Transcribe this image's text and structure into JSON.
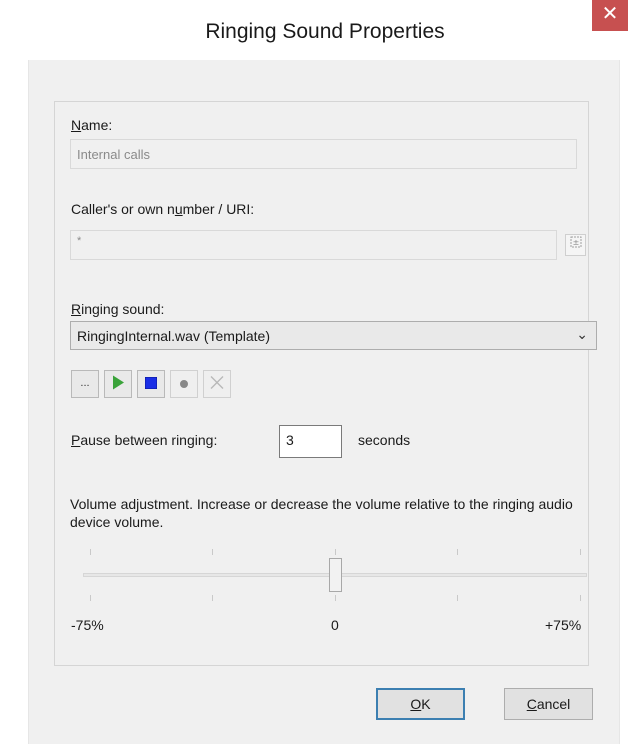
{
  "window": {
    "title": "Ringing Sound Properties"
  },
  "name": {
    "label": "Name:",
    "value": "Internal calls"
  },
  "number": {
    "label": "Caller's or own number / URI:",
    "value": "*"
  },
  "ringing": {
    "label": "Ringing sound:",
    "selected": "RingingInternal.wav (Template)",
    "toolbar": [
      {
        "id": "browse",
        "icon": "ellipsis-icon",
        "text": "...",
        "enabled": true
      },
      {
        "id": "play",
        "icon": "play-icon",
        "enabled": true
      },
      {
        "id": "stop",
        "icon": "stop-icon",
        "enabled": true
      },
      {
        "id": "record",
        "icon": "record-icon",
        "enabled": false
      },
      {
        "id": "delete",
        "icon": "delete-icon",
        "enabled": false
      }
    ]
  },
  "pause": {
    "label": "Pause between ringing:",
    "value": "3",
    "unit": "seconds"
  },
  "volume": {
    "description": "Volume adjustment. Increase or decrease the volume relative to the ringing audio device volume.",
    "min_label": "-75%",
    "mid_label": "0",
    "max_label": "+75%",
    "value": 0,
    "min": -75,
    "max": 75
  },
  "buttons": {
    "ok": "OK",
    "cancel": "Cancel"
  },
  "colors": {
    "close": "#c75050",
    "play": "#3aa33a",
    "stop": "#1a2ee6",
    "record": "#888888"
  }
}
